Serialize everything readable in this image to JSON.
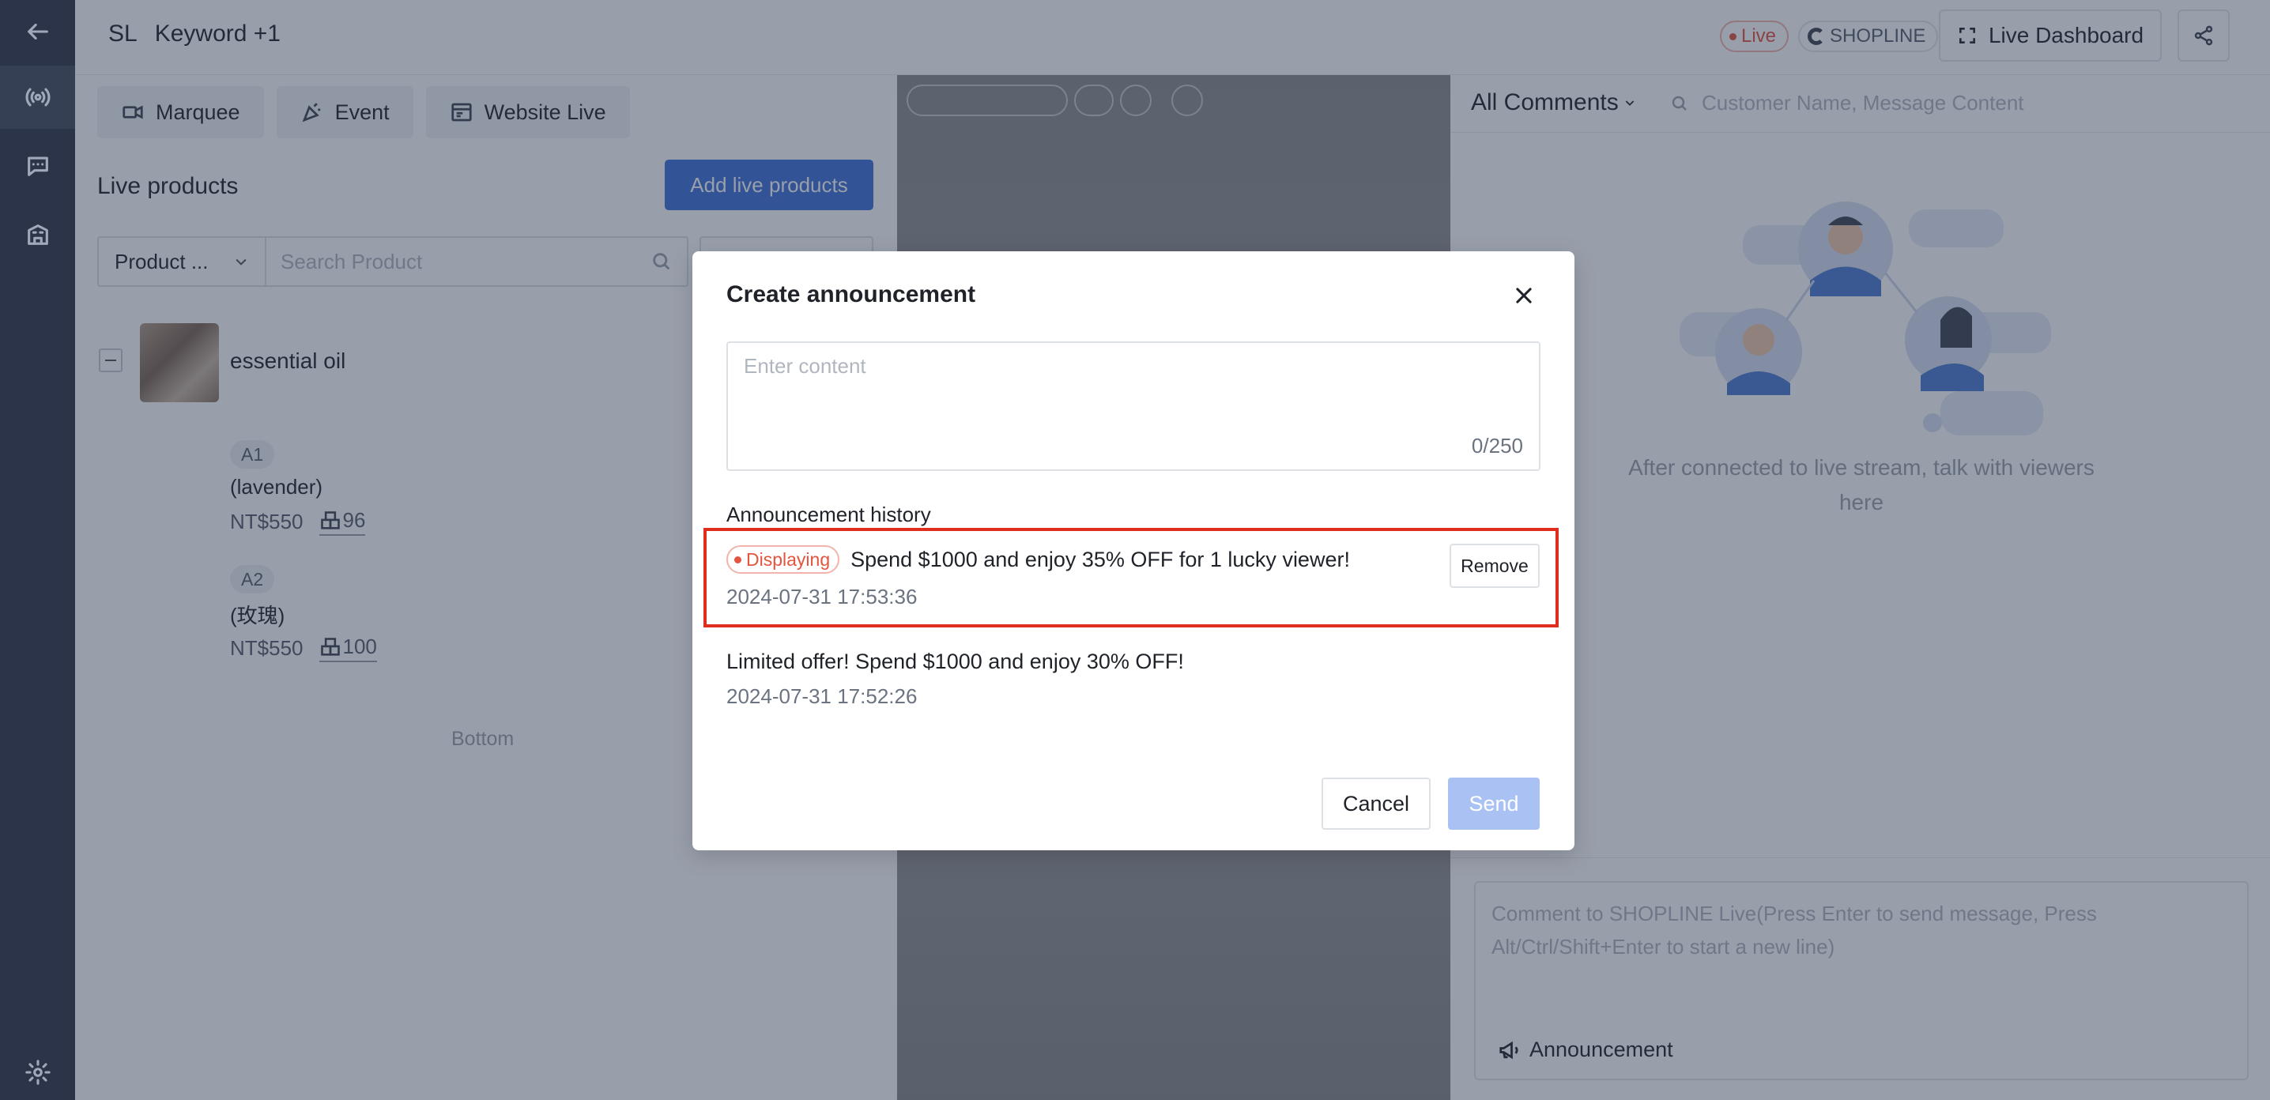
{
  "header": {
    "abbr": "SL",
    "title": "Keyword +1",
    "live_label": "Live",
    "shop_label": "SHOPLINE",
    "dashboard_label": "Live Dashboard"
  },
  "left_panel": {
    "tabs": [
      {
        "label": "Marquee",
        "icon": "marquee-icon"
      },
      {
        "label": "Event",
        "icon": "party-popper-icon"
      },
      {
        "label": "Website Live",
        "icon": "browser-icon"
      }
    ],
    "title": "Live products",
    "add_button": "Add live products",
    "filter_select": "Product ...",
    "search_placeholder": "Search Product",
    "product": {
      "name": "essential oil",
      "variants": [
        {
          "tag": "A1",
          "name": "(lavender)",
          "price": "NT$550",
          "stock": "96"
        },
        {
          "tag": "A2",
          "name": "(玫瑰)",
          "price": "NT$550",
          "stock": "100"
        }
      ]
    },
    "bottom_text": "Bottom"
  },
  "comments": {
    "filter": "All Comments",
    "search_placeholder": "Customer Name, Message Content",
    "empty_text": "After connected to live stream, talk with viewers here",
    "input_placeholder": "Comment to SHOPLINE Live(Press Enter to send message, Press Alt/Ctrl/Shift+Enter to start a new line)",
    "announcement_button": "Announcement"
  },
  "modal": {
    "title": "Create announcement",
    "content_placeholder": "Enter content",
    "char_count": "0/250",
    "history_title": "Announcement history",
    "history": [
      {
        "status": "Displaying",
        "text": "Spend $1000 and enjoy 35% OFF for 1 lucky viewer!",
        "time": "2024-07-31 17:53:36",
        "action": "Remove"
      },
      {
        "status": "",
        "text": "Limited offer! Spend $1000 and enjoy 30% OFF!",
        "time": "2024-07-31 17:52:26",
        "action": ""
      }
    ],
    "cancel_label": "Cancel",
    "send_label": "Send"
  },
  "colors": {
    "primary": "#3d6fd8",
    "live_red": "#e5543e",
    "highlight_red": "#e02e1e",
    "rail": "#2c3546"
  }
}
